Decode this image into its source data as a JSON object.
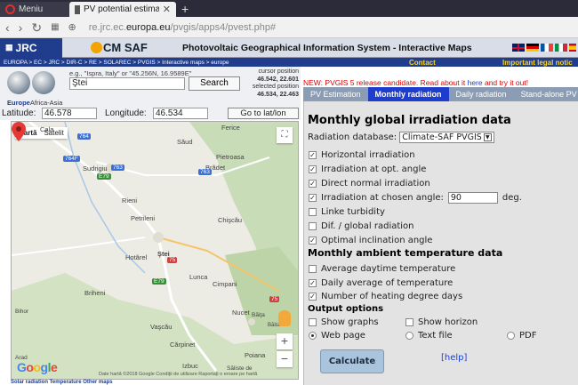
{
  "browser": {
    "tab1": "Meniu",
    "tab2": "PV potential estimation ut",
    "new_tab": "+",
    "url_pre": "re.jrc.ec.",
    "url_domain": "europa.eu",
    "url_post": "/pvgis/apps4/pvest.php#"
  },
  "header": {
    "jrc": "JRC",
    "cmsaf": "CM SAF",
    "title": "Photovoltaic Geographical Information System - Interactive Maps",
    "breadcrumb": "EUROPA > EC > JRC > DIR-C > RE > SOLAREC > PVGIS > Interactive maps > europe",
    "contact": "Contact",
    "legal": "Important legal notic"
  },
  "search": {
    "region_europe": "Europe",
    "region_africa": "Africa-Asia",
    "hint": "e.g., \"Ispra, Italy\" or \"45.256N, 16.9589E\"",
    "query": "Ştei",
    "button": "Search",
    "cursor_label": "cursor position",
    "cursor_value": "46.542, 22.601",
    "selected_label": "selected position",
    "selected_value": "46.534, 22.463",
    "lat_label": "Latitude:",
    "lat_value": "46.578",
    "lon_label": "Longitude:",
    "lon_value": "46.534",
    "goto": "Go to lat/lon"
  },
  "map": {
    "type_map": "Hartă",
    "type_sat": "Satelit",
    "places": [
      "Ferice",
      "Săud",
      "Sudrigiu",
      "Pietroasa",
      "Brădet",
      "Rieni",
      "Petrileni",
      "Chişcău",
      "Hotărel",
      "Ştei",
      "Lunca",
      "Cimpani",
      "Briheni",
      "Nucet",
      "Băiţa",
      "Vaşcău",
      "Cărpinet",
      "Poiana",
      "Izbuc",
      "Săliste de",
      "Bihor",
      "Arad",
      "Băita Pl.",
      "Cala"
    ],
    "roads": [
      "764",
      "764F",
      "763",
      "763",
      "E79",
      "75",
      "E79",
      "75"
    ],
    "google": "Google",
    "footer": "Date hartă ©2018 Google   Condiţii de utilizare   Raportaţi o eroare pe hartă"
  },
  "bottom_tabs": "Solar radiation    Temperature       Other maps",
  "panel": {
    "news_pre": "NEW: PVGIS 5 release candidate. Read about it ",
    "news_here": "here",
    "news_post": " and ",
    "news_try": "try it out!",
    "tabs": [
      "PV Estimation",
      "Monthly radiation",
      "Daily radiation",
      "Stand-alone PV"
    ],
    "title": "Monthly global irradiation data",
    "db_label": "Radiation database:",
    "db_value": "Climate-SAF PVGIS",
    "opts": [
      {
        "label": "Horizontal irradiation",
        "checked": true
      },
      {
        "label": "Irradiation at opt. angle",
        "checked": true
      },
      {
        "label": "Direct normal irradiation",
        "checked": true
      },
      {
        "label": "Irradiation at chosen angle:",
        "checked": true
      },
      {
        "label": "Linke turbidity",
        "checked": false
      },
      {
        "label": "Dif. / global radiation",
        "checked": false
      },
      {
        "label": "Optimal inclination angle",
        "checked": true
      }
    ],
    "angle_value": "90",
    "angle_unit": "deg.",
    "temp_title": "Monthly ambient temperature data",
    "temp_opts": [
      {
        "label": "Average daytime temperature",
        "checked": false
      },
      {
        "label": "Daily average of temperature",
        "checked": true
      },
      {
        "label": "Number of heating degree days",
        "checked": true
      }
    ],
    "output_title": "Output options",
    "show_graphs": "Show graphs",
    "show_horizon": "Show horizon",
    "out_web": "Web page",
    "out_text": "Text file",
    "out_pdf": "PDF",
    "calculate": "Calculate",
    "help": "[help]"
  }
}
